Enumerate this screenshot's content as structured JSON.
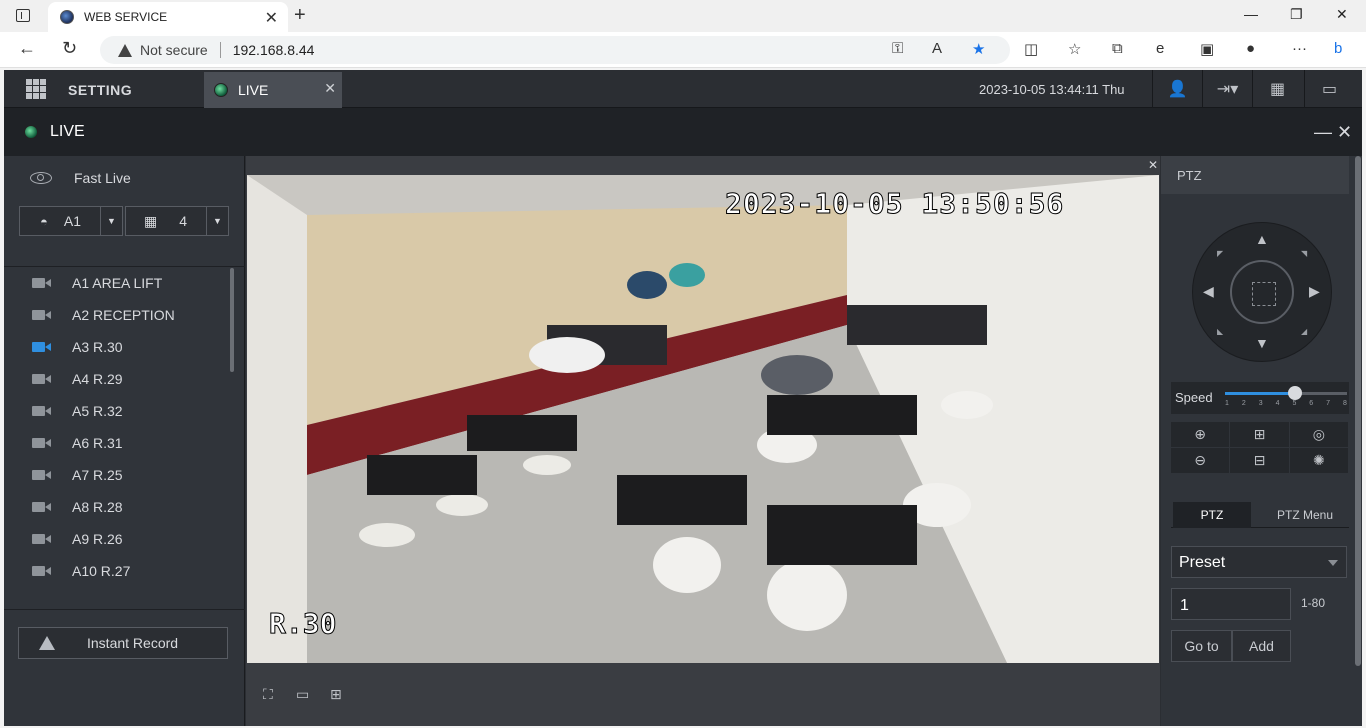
{
  "browser": {
    "tab_title": "WEB SERVICE",
    "tab_close": "✕",
    "new_tab": "+",
    "window_controls": [
      "—",
      "❐",
      "✕"
    ],
    "not_secure": "Not secure",
    "url": "192.168.8.44",
    "more": "···"
  },
  "app": {
    "menu_label": "SETTING",
    "live_tab_label": "LIVE",
    "live_tab_close": "✕",
    "datetime": "2023-10-05 13:44:11 Thu",
    "title": "LIVE",
    "title_minimize": "—",
    "title_close": "✕"
  },
  "left": {
    "fast_live": "Fast Live",
    "area_select": "A1",
    "layout_select": "4",
    "cameras": [
      {
        "label": "A1 AREA LIFT",
        "active": false
      },
      {
        "label": "A2 RECEPTION",
        "active": false
      },
      {
        "label": "A3 R.30",
        "active": true
      },
      {
        "label": "A4 R.29",
        "active": false
      },
      {
        "label": "A5 R.32",
        "active": false
      },
      {
        "label": "A6 R.31",
        "active": false
      },
      {
        "label": "A7 R.25",
        "active": false
      },
      {
        "label": "A8 R.28",
        "active": false
      },
      {
        "label": "A9 R.26",
        "active": false
      },
      {
        "label": "A10 R.27",
        "active": false
      }
    ],
    "instant_record": "Instant Record"
  },
  "video": {
    "osd_timestamp": "2023-10-05 13:50:56",
    "osd_channel": "R.30",
    "close": "✕"
  },
  "ptz": {
    "header": "PTZ",
    "speed_label": "Speed",
    "speed_value": 5,
    "speed_max": 8,
    "speed_ticks": [
      "1",
      "2",
      "3",
      "4",
      "5",
      "6",
      "7",
      "8"
    ],
    "tab_ptz": "PTZ",
    "tab_menu": "PTZ Menu",
    "preset_select": "Preset",
    "preset_value": "1",
    "preset_range": "1-80",
    "goto_button": "Go to",
    "add_button": "Add"
  },
  "colors": {
    "accent": "#2f8fe0",
    "panel": "#30343a",
    "titlebar": "#1f2226"
  }
}
